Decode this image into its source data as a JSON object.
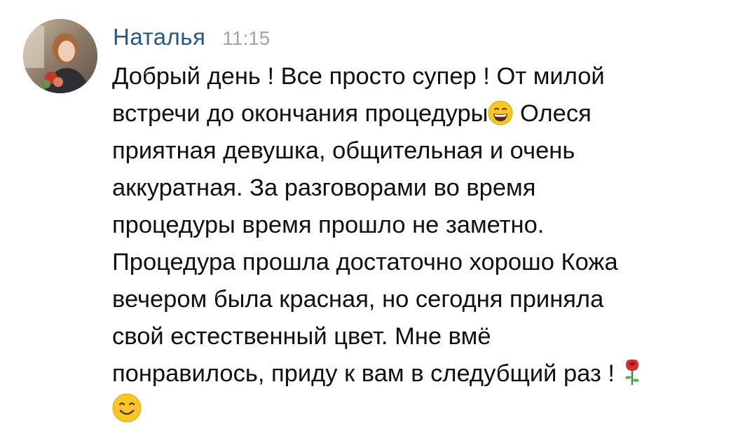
{
  "message": {
    "author": "Наталья",
    "time": "11:15",
    "lines": [
      "Добрый день ! Все просто супер ! От милой",
      "встречи до окончания процедуры",
      "Олеся",
      "приятная девушка, общительная и очень",
      "аккуратная. За разговорами во время",
      "процедуры время прошло не заметно.",
      "Процедура прошла достаточно хорошо Кожа",
      "вечером была красная, но сегодня приняла",
      "свой естественный цвет. Мне вмё",
      "понравилось, приду к вам в следубщий раз !"
    ],
    "emojis": [
      "grinning-face",
      "rose",
      "smiling-face"
    ]
  }
}
